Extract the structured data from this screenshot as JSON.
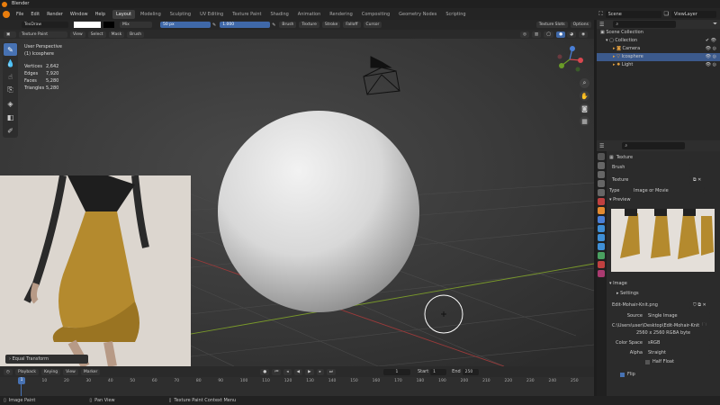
{
  "app": {
    "title": "Blender"
  },
  "menus": [
    "File",
    "Edit",
    "Render",
    "Window",
    "Help"
  ],
  "workspaces": [
    {
      "label": "Layout",
      "active": true
    },
    {
      "label": "Modeling",
      "active": false
    },
    {
      "label": "Sculpting",
      "active": false
    },
    {
      "label": "UV Editing",
      "active": false
    },
    {
      "label": "Texture Paint",
      "active": false
    },
    {
      "label": "Shading",
      "active": false
    },
    {
      "label": "Animation",
      "active": false
    },
    {
      "label": "Rendering",
      "active": false
    },
    {
      "label": "Compositing",
      "active": false
    },
    {
      "label": "Geometry Nodes",
      "active": false
    },
    {
      "label": "Scripting",
      "active": false
    }
  ],
  "header_right": {
    "scene": "Scene",
    "view_layer": "ViewLayer"
  },
  "tool_header": {
    "brush": "TexDraw",
    "blend": "Mix",
    "radius": "50 px",
    "strength": "1.000",
    "menus": [
      "Brush",
      "Texture",
      "Stroke",
      "Falloff",
      "Cursor"
    ],
    "right": [
      "Texture Slots",
      "Options"
    ]
  },
  "viewport_header": {
    "mode": "Texture Paint",
    "menus": [
      "View",
      "Select",
      "Mask",
      "Brush"
    ]
  },
  "viewport": {
    "perspective": "User Perspective",
    "object": "(1) Icosphere",
    "stats": [
      {
        "label": "Vertices",
        "value": "2,642"
      },
      {
        "label": "Edges",
        "value": "7,920"
      },
      {
        "label": "Faces",
        "value": "5,280"
      },
      {
        "label": "Triangles",
        "value": "5,280"
      }
    ],
    "op_panel": "Equal Transform"
  },
  "outliner": {
    "root": "Scene Collection",
    "items": [
      {
        "label": "Collection",
        "indent": 1,
        "selected": false
      },
      {
        "label": "Camera",
        "indent": 2,
        "selected": false
      },
      {
        "label": "Icosphere",
        "indent": 2,
        "selected": true
      },
      {
        "label": "Light",
        "indent": 2,
        "selected": false
      }
    ]
  },
  "properties": {
    "section": "Texture",
    "slot": "Brush",
    "texture_name": "Texture",
    "type_label": "Type",
    "type_value": "Image or Movie",
    "preview_label": "Preview",
    "image_label": "Image",
    "settings_label": "Settings",
    "image_file": "Edit-Mohair-Knit.png",
    "source_label": "Source",
    "source_value": "Single Image",
    "filepath": "C:\\Users\\user\\Desktop\\Edit-Mohair-Knit.png",
    "resolution": "2560 x 2560 RGBA byte",
    "colorspace_label": "Color Space",
    "colorspace_value": "sRGB",
    "alpha_label": "Alpha",
    "alpha_value": "Straight",
    "half_float": "Half Float",
    "flip": "Flip"
  },
  "timeline": {
    "menus": [
      "Playback",
      "Keying",
      "View",
      "Marker"
    ],
    "current_frame": "1",
    "start_label": "Start",
    "start": "1",
    "end_label": "End",
    "end": "250",
    "ticks": [
      "0",
      "10",
      "20",
      "30",
      "40",
      "50",
      "60",
      "70",
      "80",
      "90",
      "100",
      "110",
      "120",
      "130",
      "140",
      "150",
      "160",
      "170",
      "180",
      "190",
      "200",
      "210",
      "220",
      "230",
      "240",
      "250"
    ]
  },
  "statusbar": {
    "select": "Image Paint",
    "pan": "Pan View",
    "menu": "Texture Paint Context Menu"
  },
  "colors": {
    "accent": "#4772b3",
    "selection": "#3c5a8c",
    "orange": "#e87d0d"
  }
}
